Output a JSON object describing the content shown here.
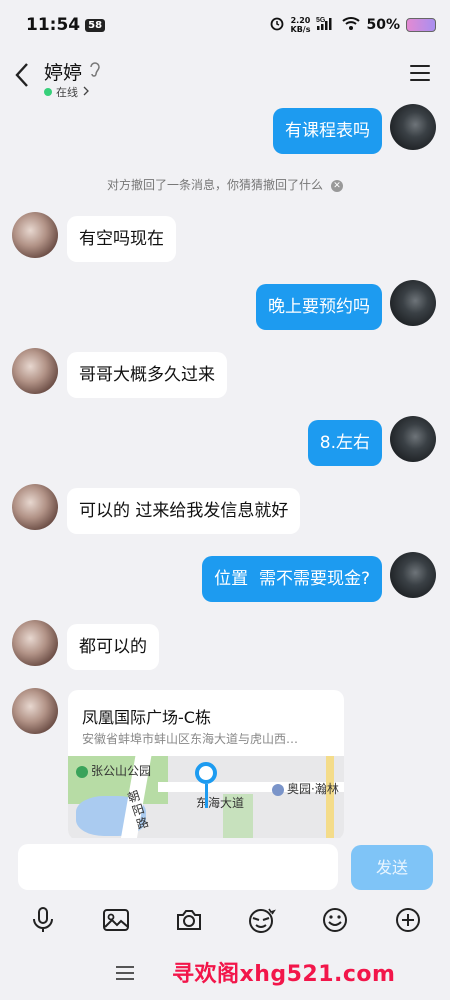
{
  "status_bar": {
    "time": "11:54",
    "badge": "58",
    "net_speed_value": "2.20",
    "net_speed_unit": "KB/s",
    "network": "5G",
    "battery": "50%"
  },
  "header": {
    "title": "婷婷",
    "status": "在线",
    "status_color": "#37d07a"
  },
  "messages": [
    {
      "side": "out",
      "text": "有课程表吗"
    },
    {
      "side": "system",
      "text": "对方撤回了一条消息，你猜猜撤回了什么"
    },
    {
      "side": "in",
      "text": "有空吗现在"
    },
    {
      "side": "out",
      "text": "晚上要预约吗"
    },
    {
      "side": "in",
      "text": "哥哥大概多久过来"
    },
    {
      "side": "out",
      "text": "8.左右"
    },
    {
      "side": "in",
      "text": "可以的 过来给我发信息就好"
    },
    {
      "side": "out",
      "text": "位置  需不需要现金?"
    },
    {
      "side": "in",
      "text": "都可以的"
    }
  ],
  "location_card": {
    "title": "凤凰国际广场-C栋",
    "address": "安徽省蚌埠市蚌山区东海大道与虎山西…",
    "map_labels": {
      "park": "张公山公园",
      "road_a": "朝阳路",
      "road_b": "东海大道",
      "poi": "奥园·瀚林"
    }
  },
  "input": {
    "placeholder": "",
    "send_label": "发送"
  },
  "toolbar": {
    "icons": [
      "microphone-icon",
      "image-icon",
      "camera-icon",
      "sticker-icon",
      "emoji-icon",
      "plus-icon"
    ]
  },
  "watermark": "寻欢阁xhg521.com",
  "colors": {
    "outgoing_bubble": "#1d9bf0",
    "incoming_bubble": "#ffffff",
    "background": "#f1f1f4",
    "watermark": "#f2164a"
  }
}
